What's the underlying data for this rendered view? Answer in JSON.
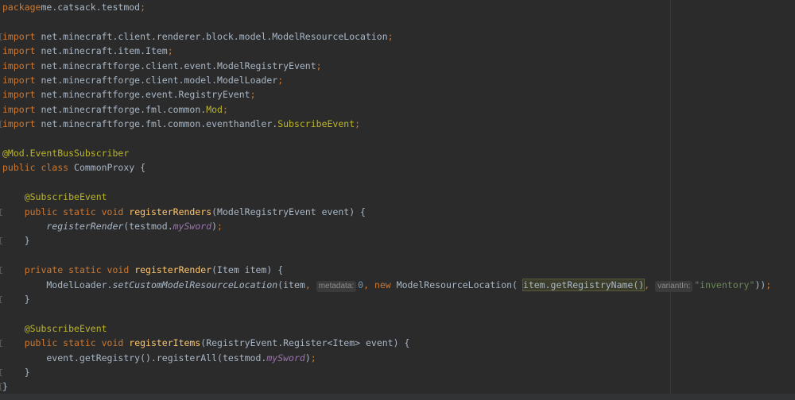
{
  "editor": {
    "lines": [
      {
        "parts": [
          [
            "kw",
            "package"
          ],
          [
            "",
            "me.catsack.testmod"
          ],
          [
            "kw",
            ";"
          ]
        ]
      },
      {
        "parts": []
      },
      {
        "fold": true,
        "parts": [
          [
            "kw",
            "import "
          ],
          [
            "",
            "net.minecraft.client.renderer.block.model.ModelResourceLocation"
          ],
          [
            "kw",
            ";"
          ]
        ]
      },
      {
        "parts": [
          [
            "kw",
            "import "
          ],
          [
            "",
            "net.minecraft.item.Item"
          ],
          [
            "kw",
            ";"
          ]
        ]
      },
      {
        "parts": [
          [
            "kw",
            "import "
          ],
          [
            "",
            "net.minecraftforge.client.event.ModelRegistryEvent"
          ],
          [
            "kw",
            ";"
          ]
        ]
      },
      {
        "parts": [
          [
            "kw",
            "import "
          ],
          [
            "",
            "net.minecraftforge.client.model.ModelLoader"
          ],
          [
            "kw",
            ";"
          ]
        ]
      },
      {
        "parts": [
          [
            "kw",
            "import "
          ],
          [
            "",
            "net.minecraftforge.event.RegistryEvent"
          ],
          [
            "kw",
            ";"
          ]
        ]
      },
      {
        "parts": [
          [
            "kw",
            "import "
          ],
          [
            "",
            "net.minecraftforge.fml.common."
          ],
          [
            "ann",
            "Mod"
          ],
          [
            "kw",
            ";"
          ]
        ]
      },
      {
        "fold": true,
        "parts": [
          [
            "kw",
            "import "
          ],
          [
            "",
            "net.minecraftforge.fml.common.eventhandler."
          ],
          [
            "ann",
            "SubscribeEvent"
          ],
          [
            "kw",
            ";"
          ]
        ]
      },
      {
        "parts": []
      },
      {
        "parts": [
          [
            "ann",
            "@Mod.EventBusSubscriber"
          ]
        ]
      },
      {
        "parts": [
          [
            "kw",
            "public class "
          ],
          [
            "",
            "CommonProxy {"
          ]
        ]
      },
      {
        "parts": []
      },
      {
        "parts": [
          [
            "",
            "    "
          ],
          [
            "ann",
            "@SubscribeEvent"
          ]
        ]
      },
      {
        "fold": true,
        "parts": [
          [
            "",
            "    "
          ],
          [
            "kw",
            "public static void "
          ],
          [
            "mth",
            "registerRenders"
          ],
          [
            "",
            "(ModelRegistryEvent event) {"
          ]
        ]
      },
      {
        "parts": [
          [
            "",
            "        "
          ],
          [
            "ital",
            "registerRender"
          ],
          [
            "",
            "(testmod."
          ],
          [
            "fld",
            "mySword"
          ],
          [
            "",
            ")"
          ],
          [
            "kw",
            ";"
          ]
        ]
      },
      {
        "fold": true,
        "parts": [
          [
            "",
            "    }"
          ]
        ]
      },
      {
        "parts": []
      },
      {
        "fold": true,
        "parts": [
          [
            "",
            "    "
          ],
          [
            "kw",
            "private static void "
          ],
          [
            "mth",
            "registerRender"
          ],
          [
            "",
            "(Item item) {"
          ]
        ]
      },
      {
        "parts": [
          [
            "",
            "        ModelLoader."
          ],
          [
            "ital",
            "setCustomModelResourceLocation"
          ],
          [
            "",
            "(item"
          ],
          [
            "kw",
            ", "
          ],
          [
            "hint",
            "metadata:"
          ],
          [
            "num",
            "0"
          ],
          [
            "kw",
            ", new "
          ],
          [
            "",
            "ModelResourceLocation( "
          ],
          [
            "hl",
            "item.getRegistryName()"
          ],
          [
            "kw",
            ", "
          ],
          [
            "hint",
            "variantIn:"
          ],
          [
            "str",
            "\"inventory\""
          ],
          [
            "",
            "))"
          ],
          [
            "kw",
            ";"
          ]
        ]
      },
      {
        "fold": true,
        "parts": [
          [
            "",
            "    }"
          ]
        ]
      },
      {
        "parts": []
      },
      {
        "parts": [
          [
            "",
            "    "
          ],
          [
            "ann",
            "@SubscribeEvent"
          ]
        ]
      },
      {
        "fold": true,
        "parts": [
          [
            "",
            "    "
          ],
          [
            "kw",
            "public static void "
          ],
          [
            "mth",
            "registerItems"
          ],
          [
            "",
            "(RegistryEvent.Register<Item> event) {"
          ]
        ]
      },
      {
        "parts": [
          [
            "",
            "        event.getRegistry().registerAll(testmod."
          ],
          [
            "fld",
            "mySword"
          ],
          [
            "",
            ")"
          ],
          [
            "kw",
            ";"
          ]
        ]
      },
      {
        "fold": true,
        "parts": [
          [
            "",
            "    }"
          ]
        ]
      },
      {
        "fold": true,
        "parts": [
          [
            "",
            "}"
          ]
        ]
      }
    ]
  }
}
